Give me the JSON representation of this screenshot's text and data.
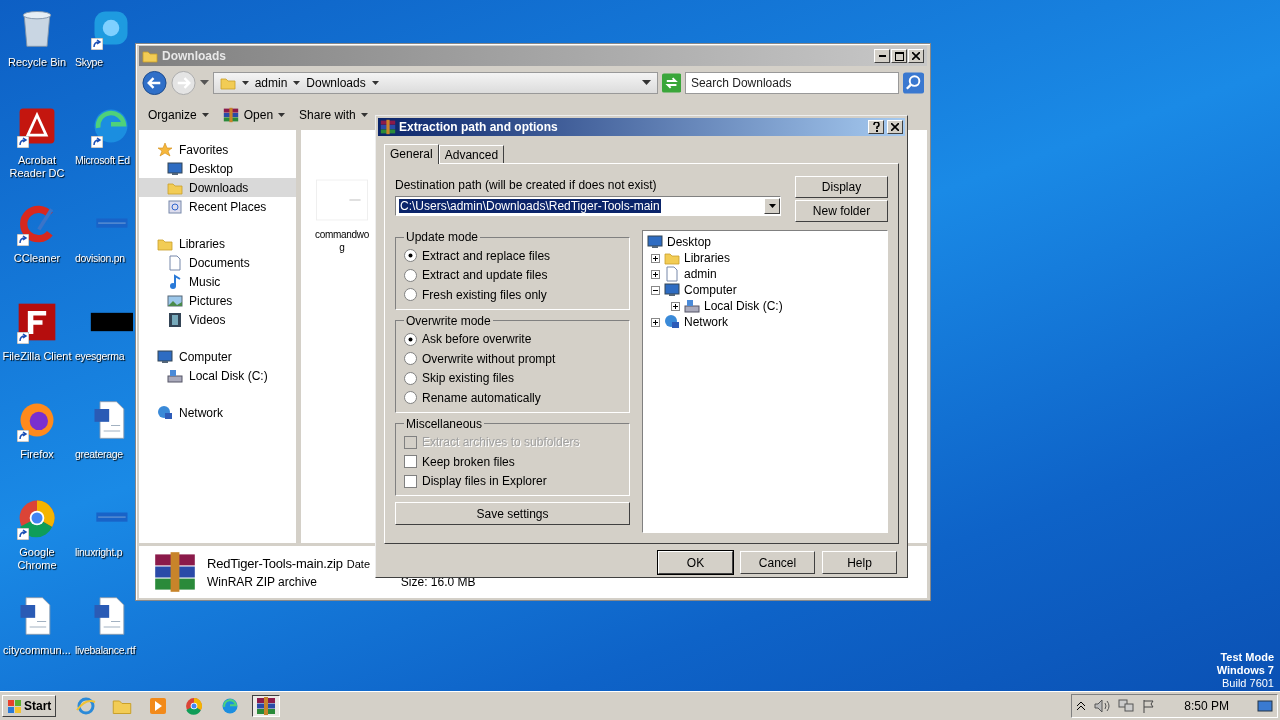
{
  "desktop": {
    "icons": [
      {
        "label": "Recycle Bin",
        "shortcut": false
      },
      {
        "label": "Skype",
        "shortcut": true
      },
      {
        "label": "Acrobat Reader DC",
        "shortcut": true
      },
      {
        "label": "Microsoft Ed",
        "shortcut": true
      },
      {
        "label": "CCleaner",
        "shortcut": true
      },
      {
        "label": "dovision.pn",
        "shortcut": false
      },
      {
        "label": "FileZilla Client",
        "shortcut": true
      },
      {
        "label": "eyesgerma",
        "shortcut": false
      },
      {
        "label": "Firefox",
        "shortcut": true
      },
      {
        "label": "greaterage",
        "shortcut": false
      },
      {
        "label": "Google Chrome",
        "shortcut": true
      },
      {
        "label": "linuxright.p",
        "shortcut": false
      },
      {
        "label": "citycommun...",
        "shortcut": false
      },
      {
        "label": "livebalance.rtf",
        "shortcut": false
      }
    ]
  },
  "explorer": {
    "title": "Downloads",
    "breadcrumb": [
      "admin",
      "Downloads"
    ],
    "search": {
      "placeholder": "Search Downloads"
    },
    "toolbar": [
      "Organize",
      "Open",
      "Share with"
    ],
    "sidebar": [
      {
        "label": "Favorites",
        "selected": false,
        "children": [
          {
            "label": "Desktop",
            "selected": false
          },
          {
            "label": "Downloads",
            "selected": true
          },
          {
            "label": "Recent Places",
            "selected": false
          }
        ]
      },
      {
        "label": "Libraries",
        "selected": false,
        "children": [
          {
            "label": "Documents",
            "selected": false
          },
          {
            "label": "Music",
            "selected": false
          },
          {
            "label": "Pictures",
            "selected": false
          },
          {
            "label": "Videos",
            "selected": false
          }
        ]
      },
      {
        "label": "Computer",
        "selected": false,
        "children": [
          {
            "label": "Local Disk (C:)",
            "selected": false
          }
        ]
      },
      {
        "label": "Network",
        "selected": false
      }
    ],
    "files": [
      {
        "name_lines": [
          "commandwo",
          "g"
        ]
      }
    ],
    "details": {
      "name": "RedTiger-Tools-main.zip",
      "date_label": "Date",
      "type": "WinRAR ZIP archive",
      "size": "Size: 16.0 MB"
    }
  },
  "dialog": {
    "title": "Extraction path and options",
    "tabs": [
      {
        "label": "General",
        "selected": true
      },
      {
        "label": "Advanced",
        "selected": false
      }
    ],
    "destination_label": "Destination path (will be created if does not exist)",
    "path": "C:\\Users\\admin\\Downloads\\RedTiger-Tools-main",
    "side_buttons": [
      "Display",
      "New folder"
    ],
    "groups": [
      {
        "title": "Update mode",
        "kind": "radio",
        "options": [
          {
            "label": "Extract and replace files",
            "selected": true
          },
          {
            "label": "Extract and update files",
            "selected": false
          },
          {
            "label": "Fresh existing files only",
            "selected": false
          }
        ]
      },
      {
        "title": "Overwrite mode",
        "kind": "radio",
        "options": [
          {
            "label": "Ask before overwrite",
            "selected": true
          },
          {
            "label": "Overwrite without prompt",
            "selected": false
          },
          {
            "label": "Skip existing files",
            "selected": false
          },
          {
            "label": "Rename automatically",
            "selected": false
          }
        ]
      },
      {
        "title": "Miscellaneous",
        "kind": "checkbox",
        "options": [
          {
            "label": "Extract archives to subfolders",
            "checked": false,
            "disabled": true
          },
          {
            "label": "Keep broken files",
            "checked": false,
            "disabled": false
          },
          {
            "label": "Display files in Explorer",
            "checked": false,
            "disabled": false
          }
        ]
      }
    ],
    "save_button": "Save settings",
    "tree": {
      "label": "Desktop",
      "children": [
        {
          "label": "Libraries",
          "expanded": false
        },
        {
          "label": "admin",
          "expanded": false
        },
        {
          "label": "Computer",
          "expanded": true,
          "children": [
            {
              "label": "Local Disk (C:)",
              "expanded": false
            }
          ]
        },
        {
          "label": "Network",
          "expanded": false
        }
      ]
    },
    "footer_buttons": [
      {
        "label": "OK",
        "default": true
      },
      {
        "label": "Cancel",
        "default": false
      },
      {
        "label": "Help",
        "default": false
      }
    ]
  },
  "taskbar": {
    "start": "Start",
    "apps": [
      {
        "selected": false
      },
      {
        "selected": false
      },
      {
        "selected": false
      },
      {
        "selected": false
      },
      {
        "selected": false
      },
      {
        "selected": true
      }
    ],
    "time": "8:50 PM"
  },
  "os_notice": [
    "Test Mode",
    "Windows 7",
    "Build 7601"
  ]
}
